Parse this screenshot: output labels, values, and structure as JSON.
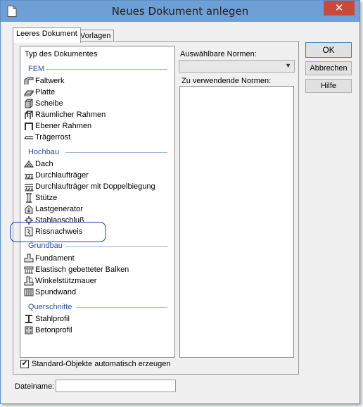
{
  "window": {
    "title": "Neues Dokument anlegen",
    "close_glyph": "✕"
  },
  "tabs": [
    {
      "label": "Leeres Dokument"
    },
    {
      "label": "Vorlagen"
    }
  ],
  "doclist": {
    "header": "Typ des Dokumentes",
    "groups": {
      "fem": "FEM",
      "hochbau": "Hochbau",
      "grundbau": "Grundbau",
      "querschnitte": "Querschnitte"
    },
    "items": {
      "faltwerk": "Faltwerk",
      "platte": "Platte",
      "scheibe": "Scheibe",
      "raeumlicher_rahmen": "Räumlicher Rahmen",
      "ebener_rahmen": "Ebener Rahmen",
      "traegerrost": "Trägerrost",
      "dach": "Dach",
      "durchlauftraeger": "Durchlaufträger",
      "durchlauftraeger_doppel": "Durchlaufträger mit Doppelbiegung",
      "stuetze": "Stütze",
      "lastgenerator": "Lastgenerator",
      "stahlanschluss": "Stahlanschluß",
      "rissnachweis": "Rissnachweis",
      "fundament": "Fundament",
      "balken": "Elastisch gebetteter Balken",
      "winkelstuetzmauer": "Winkelstützmauer",
      "spundwand": "Spundwand",
      "stahlprofil": "Stahlprofil",
      "betonprofil": "Betonprofil"
    }
  },
  "norms": {
    "available_label": "Auswählbare Normen:",
    "available_value": "",
    "used_label": "Zu verwendende Normen:"
  },
  "buttons": {
    "ok": "OK",
    "cancel": "Abbrechen",
    "help": "Hilfe"
  },
  "standard_objects": {
    "label": "Standard-Objekte automatisch erzeugen",
    "checked": true,
    "mark": "✔"
  },
  "filename": {
    "label": "Dateiname:",
    "value": ""
  },
  "colors": {
    "titlebar": "#6fa0d5",
    "close": "#c94a3c",
    "group_text": "#2a4e9c",
    "highlight": "#1a3fb5"
  }
}
